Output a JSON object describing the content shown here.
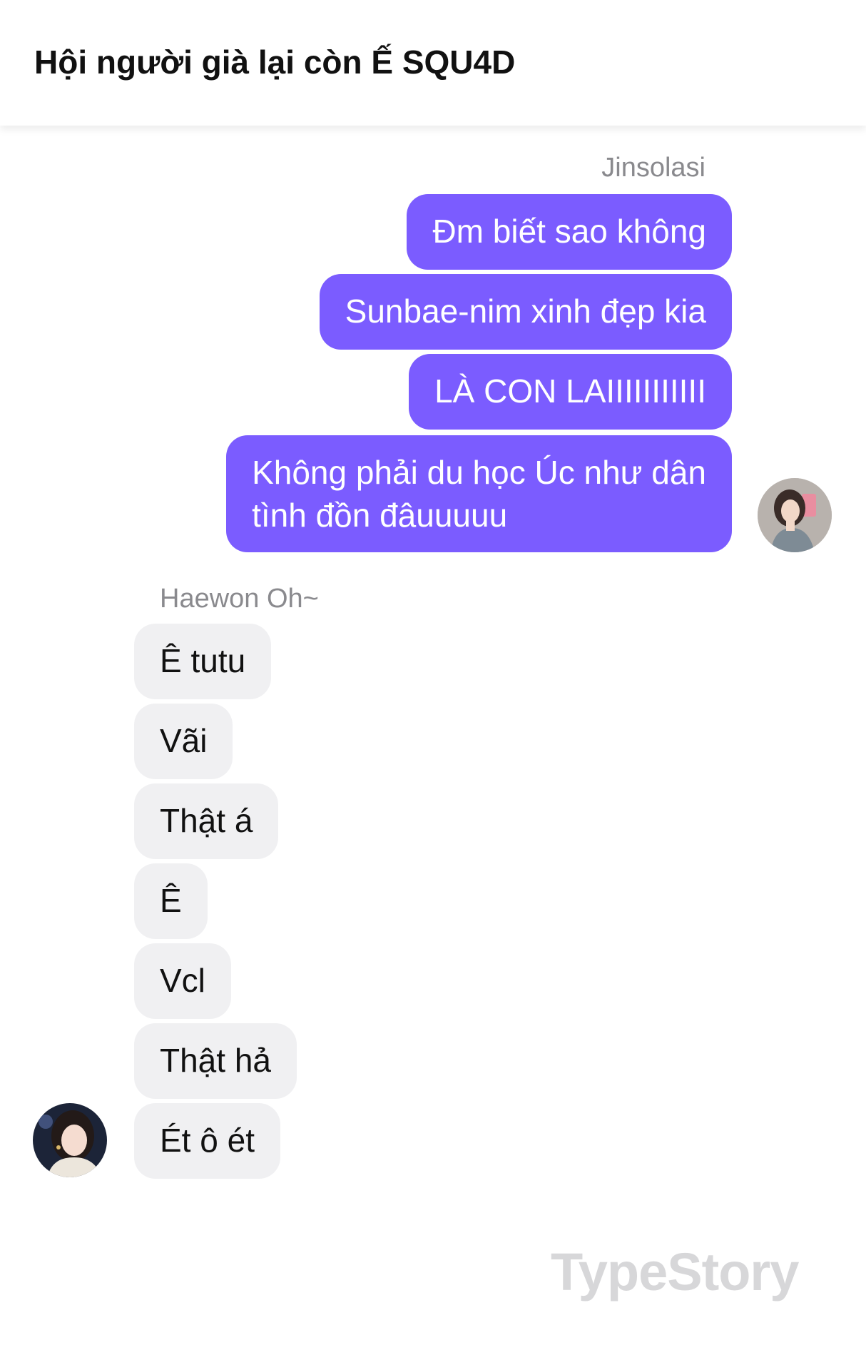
{
  "header": {
    "title": "Hội người già lại còn Ế SQU4D"
  },
  "outgoing": {
    "sender": "Jinsolasi",
    "messages": [
      "Đm biết sao không",
      "Sunbae-nim xinh đẹp kia",
      "LÀ CON LAIIIIIIIIIII",
      "Không phải du học Úc như dân",
      "tình đồn đâuuuuu"
    ]
  },
  "incoming": {
    "sender": "Haewon Oh~",
    "messages": [
      "Ê tutu",
      "Vãi",
      "Thật á",
      "Ê",
      "Vcl",
      "Thật hả",
      "Ét ô ét"
    ]
  },
  "watermark": "TypeStory",
  "colors": {
    "outgoing_bubble": "#7b5cff",
    "incoming_bubble": "#f0f0f2",
    "sender_label": "#8a8a8e"
  }
}
